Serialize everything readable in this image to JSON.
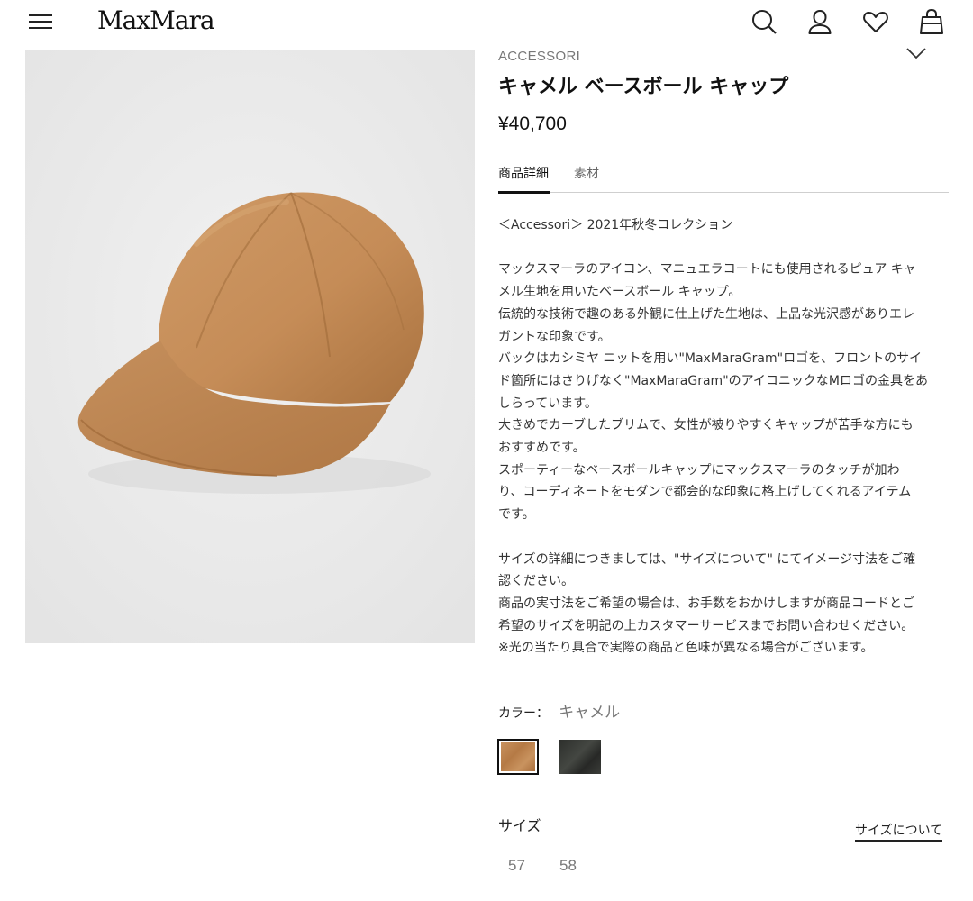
{
  "header": {
    "logo": "MaxMara",
    "icons": [
      "menu-icon",
      "search-icon",
      "account-icon",
      "heart-icon",
      "bag-icon"
    ]
  },
  "product": {
    "category": "ACCESSORI",
    "title": "キャメル ベースボール キャップ",
    "price": "¥40,700",
    "image_icon": "cap-image"
  },
  "tabs": [
    {
      "label": "商品詳細",
      "active": true
    },
    {
      "label": "素材",
      "active": false
    }
  ],
  "description": {
    "lines": [
      "＜Accessori＞ 2021年秋冬コレクション",
      "",
      "マックスマーラのアイコン、マニュエラコートにも使用されるピュア キャ",
      "メル生地を用いたベースボール キャップ。",
      "伝統的な技術で趣のある外観に仕上げた生地は、上品な光沢感がありエレ",
      "ガントな印象です。",
      "バックはカシミヤ ニットを用い\"MaxMaraGram\"ロゴを、フロントのサイ",
      "ド箇所にはさりげなく\"MaxMaraGram\"のアイコニックなMロゴの金具をあ",
      "しらっています。",
      "大きめでカーブしたブリムで、女性が被りやすくキャップが苦手な方にも",
      "おすすめです。",
      "スポーティーなベースボールキャップにマックスマーラのタッチが加わ",
      "り、コーディネートをモダンで都会的な印象に格上げしてくれるアイテム",
      "です。",
      "",
      "サイズの詳細につきましては、\"サイズについて\" にてイメージ寸法をご確",
      "認ください。",
      "商品の実寸法をご希望の場合は、お手数をおかけしますが商品コードとご",
      "希望のサイズを明記の上カスタマーサービスまでお問い合わせください。",
      "※光の当たり具合で実際の商品と色味が異なる場合がございます。"
    ]
  },
  "color": {
    "label": "カラー：",
    "selected": "キャメル",
    "swatches": [
      {
        "name": "camel",
        "hex": "#b98150",
        "selected": true
      },
      {
        "name": "black",
        "hex": "#363834",
        "selected": false
      }
    ]
  },
  "size": {
    "label": "サイズ",
    "guide_label": "サイズについて",
    "options": [
      "57",
      "58"
    ]
  }
}
